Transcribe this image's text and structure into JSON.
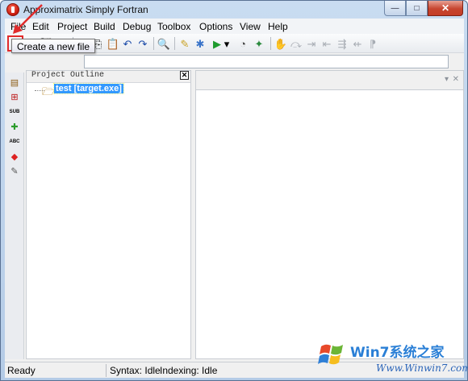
{
  "window": {
    "title": "Approximatrix Simply Fortran",
    "minimize_glyph": "—",
    "maximize_glyph": "□",
    "close_glyph": "✕"
  },
  "menu": [
    "File",
    "Edit",
    "Project",
    "Build",
    "Debug",
    "Toolbox",
    "Options",
    "View",
    "Help"
  ],
  "toolbar": {
    "buttons": [
      {
        "name": "new-file-icon",
        "glyph": "🗋"
      },
      {
        "name": "open-folder-icon",
        "glyph": "📂"
      },
      {
        "name": "save-icon",
        "glyph": "💾"
      },
      {
        "name": "close-file-icon",
        "glyph": "🗙"
      },
      {
        "name": "cut-icon",
        "glyph": "✂"
      },
      {
        "name": "copy-icon",
        "glyph": "⎘"
      },
      {
        "name": "paste-icon",
        "glyph": "📋"
      },
      {
        "name": "undo-icon",
        "glyph": "↶"
      },
      {
        "name": "redo-icon",
        "glyph": "↷"
      },
      {
        "name": "find-icon",
        "glyph": "🔍"
      },
      {
        "name": "build-icon",
        "glyph": "✎"
      },
      {
        "name": "settings-gear-icon",
        "glyph": "✱"
      },
      {
        "name": "run-icon",
        "glyph": "▶"
      },
      {
        "name": "run-dropdown-icon",
        "glyph": "▾"
      },
      {
        "name": "stopwatch-icon",
        "glyph": "◔"
      },
      {
        "name": "debug-bug-icon",
        "glyph": "✦"
      },
      {
        "name": "debug-hand-icon",
        "glyph": "✋"
      },
      {
        "name": "step-over-icon",
        "glyph": "⤼"
      },
      {
        "name": "step-into-icon",
        "glyph": "⇥"
      },
      {
        "name": "step-out-icon",
        "glyph": "⇤"
      },
      {
        "name": "indent-icon",
        "glyph": "⇶"
      },
      {
        "name": "outdent-icon",
        "glyph": "⇷"
      },
      {
        "name": "comment-icon",
        "glyph": "⁋"
      }
    ],
    "tooltip": "Create a new file"
  },
  "left_strip": [
    {
      "name": "project-icon",
      "glyph": "▤"
    },
    {
      "name": "structure-icon",
      "glyph": "⊞"
    },
    {
      "name": "subroutine-icon",
      "glyph": "SUB"
    },
    {
      "name": "module-icon",
      "glyph": "✚"
    },
    {
      "name": "variable-icon",
      "glyph": "ABC"
    },
    {
      "name": "types-icon",
      "glyph": "◆"
    },
    {
      "name": "tools-icon",
      "glyph": "✎"
    }
  ],
  "project_outline": {
    "title": "Project Outline",
    "close_glyph": "✕",
    "items": [
      {
        "label": "test [target.exe]",
        "icon": "project-folder-icon"
      }
    ]
  },
  "editor": {
    "dropdown_glyph": "▾",
    "close_glyph": "✕"
  },
  "status": {
    "state": "Ready",
    "syntax": "Syntax: Idle",
    "indexing": "Indexing: Idle"
  },
  "watermark": {
    "brand_text": "Win7系统之家",
    "url_text": "Www.Winwin7.com"
  },
  "colors": {
    "highlight": "#e02b2b",
    "selection": "#3399ff",
    "title_bar": "#b4cbe6"
  }
}
